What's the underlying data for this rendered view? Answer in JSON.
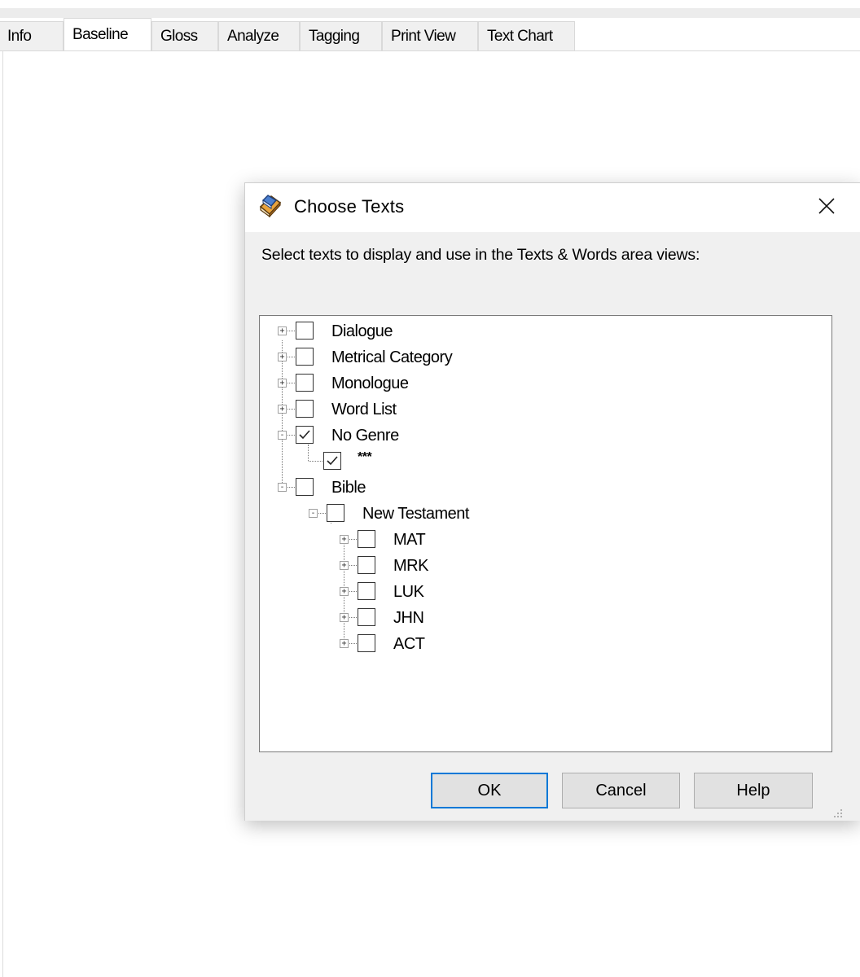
{
  "tabs": [
    {
      "label": "Info",
      "active": false
    },
    {
      "label": "Baseline",
      "active": true
    },
    {
      "label": "Gloss",
      "active": false
    },
    {
      "label": "Analyze",
      "active": false
    },
    {
      "label": "Tagging",
      "active": false
    },
    {
      "label": "Print View",
      "active": false
    },
    {
      "label": "Text Chart",
      "active": false
    }
  ],
  "dialog": {
    "title": "Choose Texts",
    "icon": "books-icon",
    "close_glyph": "✕",
    "instruction": "Select texts to display and use in the Texts & Words area views:",
    "tree": [
      {
        "label": "Dialogue",
        "expander": "+",
        "checked": false
      },
      {
        "label": "Metrical Category",
        "expander": "+",
        "checked": false
      },
      {
        "label": "Monologue",
        "expander": "+",
        "checked": false
      },
      {
        "label": "Word List",
        "expander": "+",
        "checked": false
      },
      {
        "label": "No Genre",
        "expander": "-",
        "checked": true
      },
      {
        "label": "***",
        "expander": "",
        "checked": true
      },
      {
        "label": "Bible",
        "expander": "-",
        "checked": false
      },
      {
        "label": "New Testament",
        "expander": "-",
        "checked": false
      },
      {
        "label": "MAT",
        "expander": "+",
        "checked": false
      },
      {
        "label": "MRK",
        "expander": "+",
        "checked": false
      },
      {
        "label": "LUK",
        "expander": "+",
        "checked": false
      },
      {
        "label": "JHN",
        "expander": "+",
        "checked": false
      },
      {
        "label": "ACT",
        "expander": "+",
        "checked": false
      }
    ],
    "buttons": {
      "ok": "OK",
      "cancel": "Cancel",
      "help": "Help"
    },
    "accent_color": "#0078d7"
  }
}
